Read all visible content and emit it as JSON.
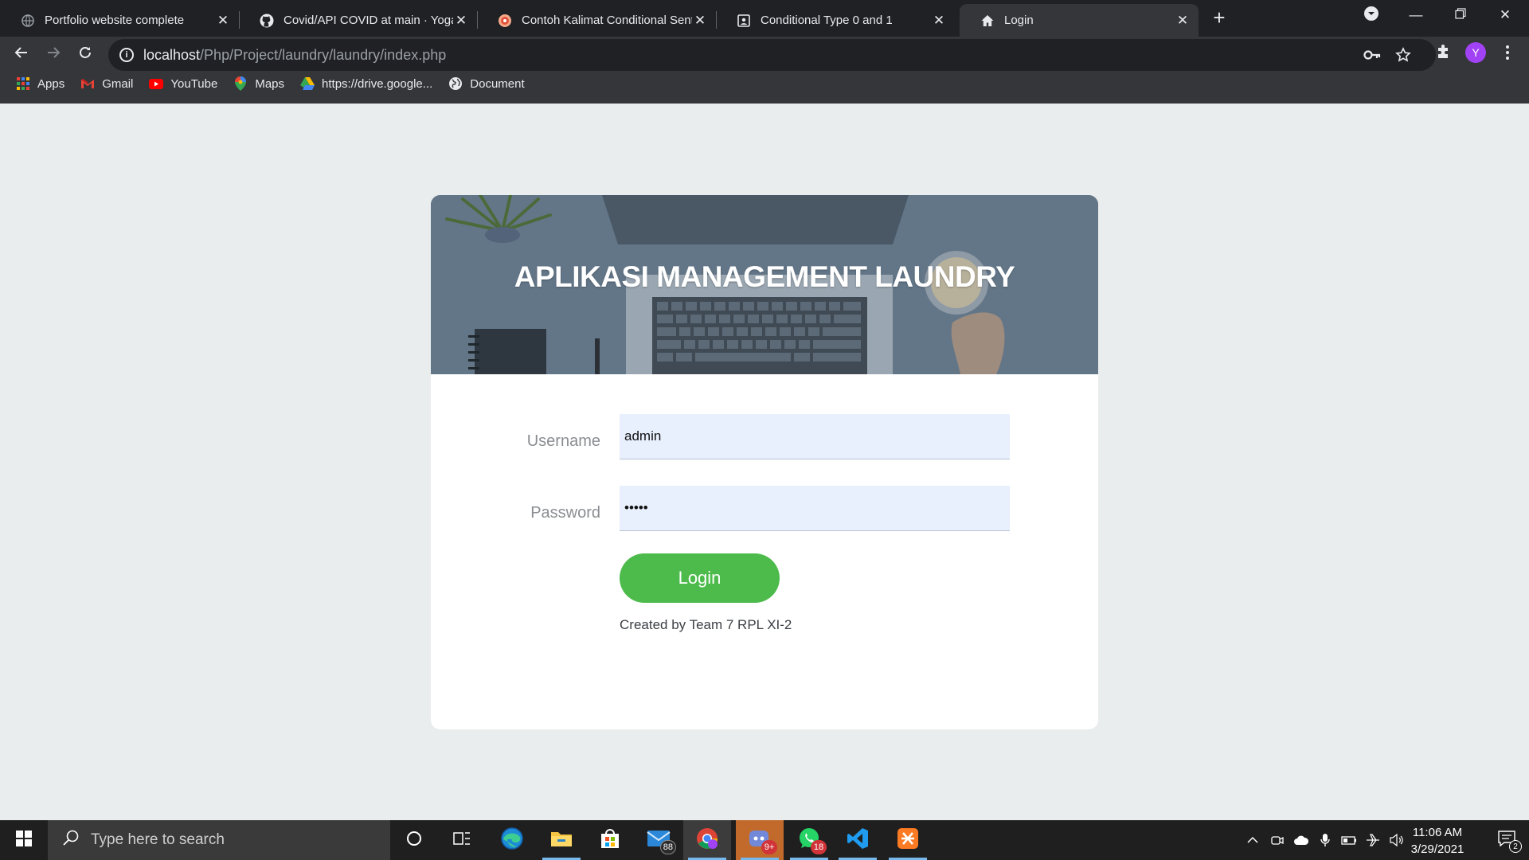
{
  "browser": {
    "tabs": [
      {
        "title": "Portfolio website complete",
        "icon": "globe-icon"
      },
      {
        "title": "Covid/API COVID at main · Yogap",
        "icon": "github-icon"
      },
      {
        "title": "Contoh Kalimat Conditional Sent",
        "icon": "site-icon"
      },
      {
        "title": "Conditional Type 0 and 1",
        "icon": "page-icon"
      },
      {
        "title": "Login",
        "icon": "home-icon"
      }
    ],
    "new_tab": "+",
    "url_host": "localhost",
    "url_path": "/Php/Project/laundry/laundry/index.php",
    "profile_initial": "Y",
    "bookmarks": [
      {
        "label": "Apps",
        "icon": "apps-grid-icon"
      },
      {
        "label": "Gmail",
        "icon": "gmail-icon"
      },
      {
        "label": "YouTube",
        "icon": "youtube-icon"
      },
      {
        "label": "Maps",
        "icon": "maps-icon"
      },
      {
        "label": "https://drive.google...",
        "icon": "drive-icon"
      },
      {
        "label": "Document",
        "icon": "globe-icon"
      }
    ]
  },
  "page": {
    "title": "APLIKASI MANAGEMENT LAUNDRY",
    "username_label": "Username",
    "username_value": "admin",
    "password_label": "Password",
    "password_value": "admin",
    "login_button": "Login",
    "credit": "Created by Team 7 RPL XI-2"
  },
  "taskbar": {
    "search_placeholder": "Type here to search",
    "mail_badge": "88",
    "discord_badge": "9+",
    "whatsapp_badge": "18",
    "time": "11:06 AM",
    "date": "3/29/2021",
    "notification_count": "2"
  },
  "colors": {
    "accent_green": "#4dbb4b",
    "input_bg": "#e8f0fe",
    "page_bg": "#eaeded"
  }
}
